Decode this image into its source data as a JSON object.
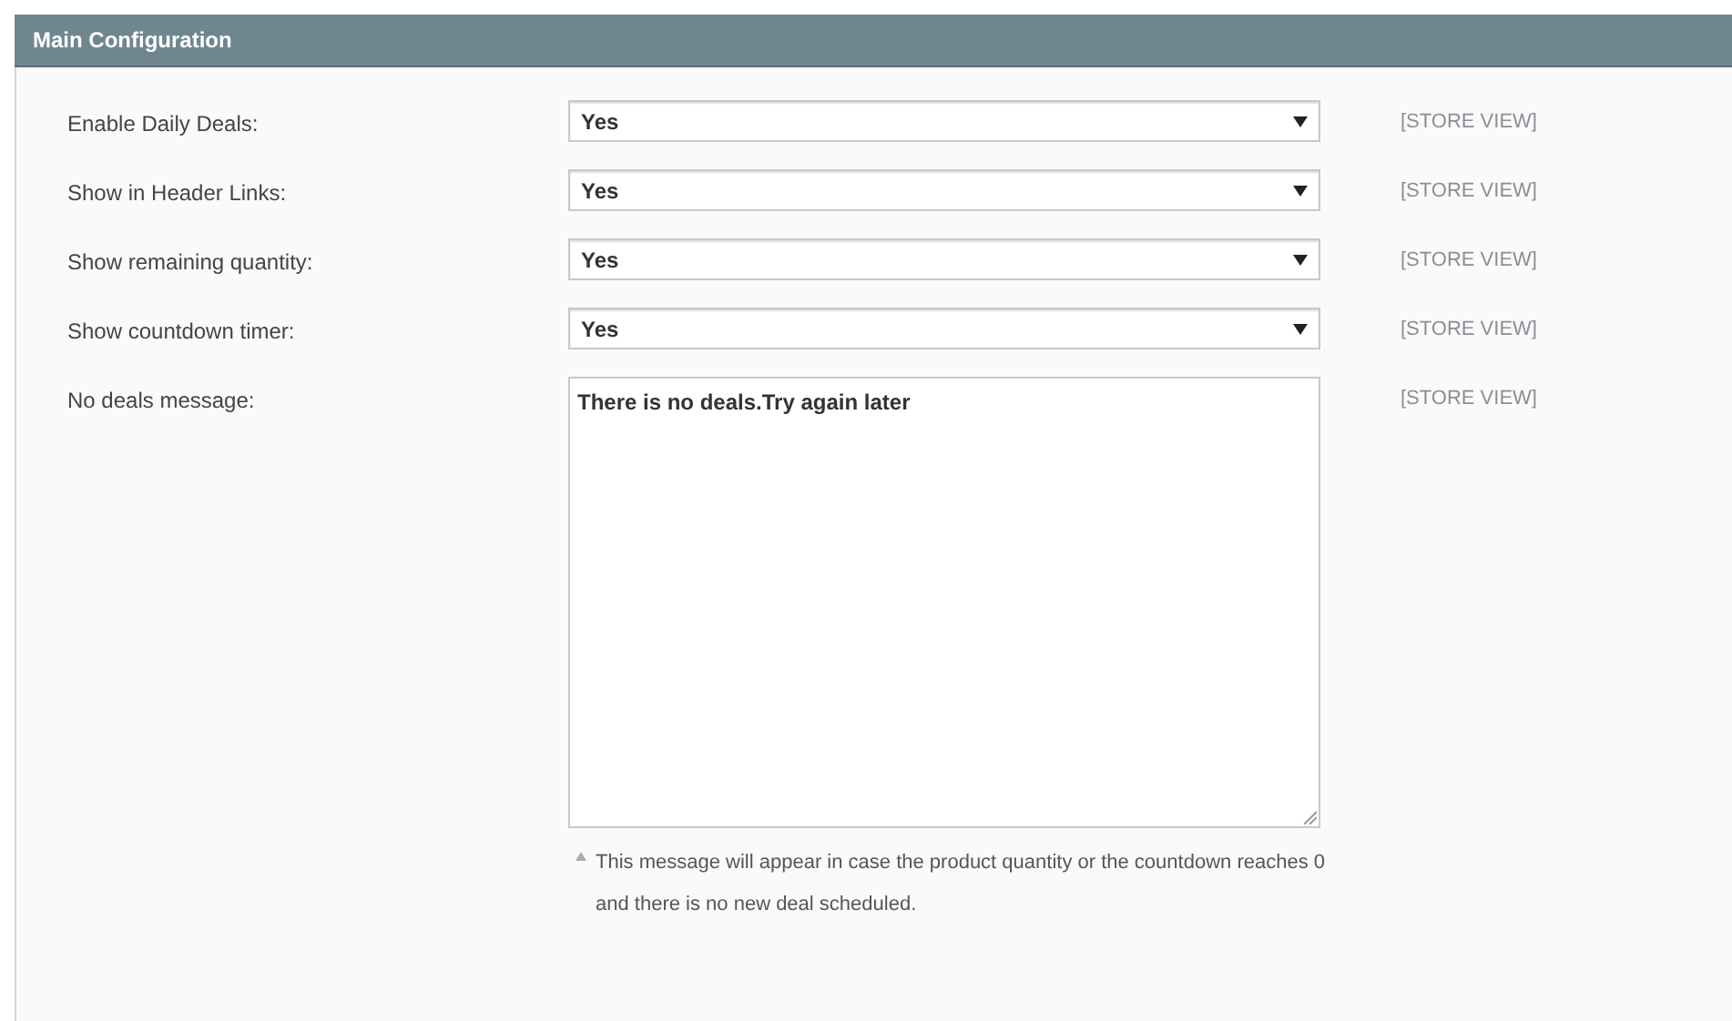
{
  "section": {
    "title": "Main Configuration"
  },
  "fields": [
    {
      "kind": "select",
      "label": "Enable Daily Deals:",
      "value": "Yes",
      "scope": "[STORE VIEW]"
    },
    {
      "kind": "select",
      "label": "Show in Header Links:",
      "value": "Yes",
      "scope": "[STORE VIEW]"
    },
    {
      "kind": "select",
      "label": "Show remaining quantity:",
      "value": "Yes",
      "scope": "[STORE VIEW]"
    },
    {
      "kind": "select",
      "label": "Show countdown timer:",
      "value": "Yes",
      "scope": "[STORE VIEW]"
    },
    {
      "kind": "textarea",
      "label": "No deals message:",
      "value": "There is no deals.Try again later",
      "scope": "[STORE VIEW]",
      "note": "This message will appear in case the product quantity or the countdown reaches 0 and there is no new deal scheduled."
    }
  ]
}
